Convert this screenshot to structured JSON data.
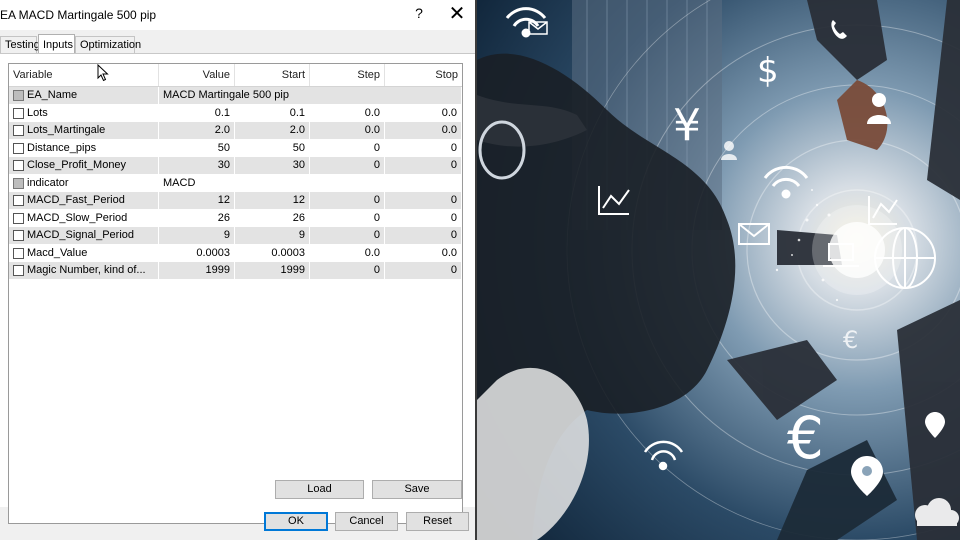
{
  "window": {
    "title": "EA MACD Martingale 500 pip",
    "help": "?",
    "close": "✕"
  },
  "tabs": [
    {
      "label": "Testing"
    },
    {
      "label": "Inputs"
    },
    {
      "label": "Optimization"
    }
  ],
  "columns": [
    "Variable",
    "Value",
    "Start",
    "Step",
    "Stop"
  ],
  "rows": [
    {
      "variable": "EA_Name",
      "value": "MACD Martingale 500 pip",
      "start": "",
      "step": "",
      "stop": ""
    },
    {
      "variable": "Lots",
      "value": "0.1",
      "start": "0.1",
      "step": "0.0",
      "stop": "0.0"
    },
    {
      "variable": "Lots_Martingale",
      "value": "2.0",
      "start": "2.0",
      "step": "0.0",
      "stop": "0.0"
    },
    {
      "variable": "Distance_pips",
      "value": "50",
      "start": "50",
      "step": "0",
      "stop": "0"
    },
    {
      "variable": "Close_Profit_Money",
      "value": "30",
      "start": "30",
      "step": "0",
      "stop": "0"
    },
    {
      "variable": "indicator",
      "value": "MACD",
      "start": "",
      "step": "",
      "stop": ""
    },
    {
      "variable": "MACD_Fast_Period",
      "value": "12",
      "start": "12",
      "step": "0",
      "stop": "0"
    },
    {
      "variable": "MACD_Slow_Period",
      "value": "26",
      "start": "26",
      "step": "0",
      "stop": "0"
    },
    {
      "variable": "MACD_Signal_Period",
      "value": "9",
      "start": "9",
      "step": "0",
      "stop": "0"
    },
    {
      "variable": "Macd_Value",
      "value": "0.0003",
      "start": "0.0003",
      "step": "0.0",
      "stop": "0.0"
    },
    {
      "variable": "Magic Number, kind of...",
      "value": "1999",
      "start": "1999",
      "step": "0",
      "stop": "0"
    }
  ],
  "buttons": {
    "load": "Load",
    "save": "Save",
    "ok": "OK",
    "cancel": "Cancel",
    "reset": "Reset"
  },
  "photo": {
    "icons": [
      "wifi-icon",
      "dollar-icon",
      "yen-icon",
      "globe-icon",
      "chart-icon",
      "mail-icon",
      "euro-icon",
      "location-pin-icon",
      "person-icon",
      "phone-icon",
      "laptop-icon"
    ],
    "currency_glyphs": {
      "yen": "¥",
      "dollar": "$",
      "euro": "€"
    }
  }
}
